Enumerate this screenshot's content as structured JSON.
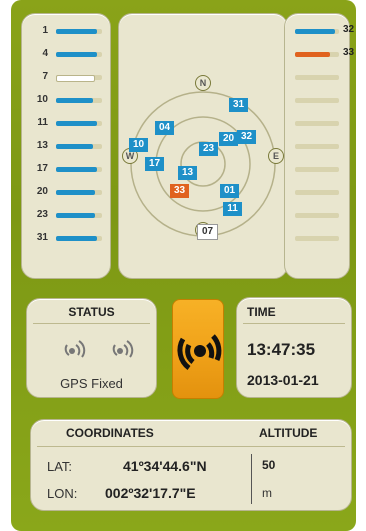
{
  "colors": {
    "bezel": "#7d9814",
    "panel": "#e9e6cf",
    "bar_blue": "#1e90c8",
    "bar_white": "#ffffff",
    "bar_orange": "#e0621e",
    "center_button": "#f1a31a"
  },
  "left_bars": [
    {
      "id": "1",
      "level": 0.9,
      "color": "blue"
    },
    {
      "id": "4",
      "level": 0.9,
      "color": "blue"
    },
    {
      "id": "7",
      "level": 0.8,
      "color": "white"
    },
    {
      "id": "10",
      "level": 0.8,
      "color": "blue"
    },
    {
      "id": "11",
      "level": 0.9,
      "color": "blue"
    },
    {
      "id": "13",
      "level": 0.8,
      "color": "blue"
    },
    {
      "id": "17",
      "level": 0.9,
      "color": "blue"
    },
    {
      "id": "20",
      "level": 0.85,
      "color": "blue"
    },
    {
      "id": "23",
      "level": 0.85,
      "color": "blue"
    },
    {
      "id": "31",
      "level": 0.9,
      "color": "blue"
    }
  ],
  "right_bars": [
    {
      "id": "32",
      "level": 0.9,
      "color": "blue"
    },
    {
      "id": "33",
      "level": 0.8,
      "color": "orange"
    },
    {
      "id": "",
      "level": 0,
      "color": "none"
    },
    {
      "id": "",
      "level": 0,
      "color": "none"
    },
    {
      "id": "",
      "level": 0,
      "color": "none"
    },
    {
      "id": "",
      "level": 0,
      "color": "none"
    },
    {
      "id": "",
      "level": 0,
      "color": "none"
    },
    {
      "id": "",
      "level": 0,
      "color": "none"
    },
    {
      "id": "",
      "level": 0,
      "color": "none"
    },
    {
      "id": "",
      "level": 0,
      "color": "none"
    }
  ],
  "compass": {
    "north": "N",
    "east": "E",
    "west": "W",
    "south": "S"
  },
  "sky_sats": [
    {
      "id": "31",
      "color": "blue"
    },
    {
      "id": "04",
      "color": "blue"
    },
    {
      "id": "10",
      "color": "blue"
    },
    {
      "id": "20",
      "color": "blue"
    },
    {
      "id": "32",
      "color": "blue"
    },
    {
      "id": "23",
      "color": "blue"
    },
    {
      "id": "17",
      "color": "blue"
    },
    {
      "id": "13",
      "color": "blue"
    },
    {
      "id": "33",
      "color": "orange"
    },
    {
      "id": "01",
      "color": "blue"
    },
    {
      "id": "11",
      "color": "blue"
    },
    {
      "id": "07",
      "color": "white"
    }
  ],
  "status": {
    "title": "STATUS",
    "text": "GPS Fixed"
  },
  "time": {
    "title": "TIME",
    "clock": "13:47:35",
    "date": "2013-01-21"
  },
  "coordinates": {
    "title": "COORDINATES",
    "lat_label": "LAT:",
    "lat_value": "41º34'44.6\"N",
    "lon_label": "LON:",
    "lon_value": "002º32'17.7\"E"
  },
  "altitude": {
    "title": "ALTITUDE",
    "value": "50",
    "unit": "m"
  }
}
